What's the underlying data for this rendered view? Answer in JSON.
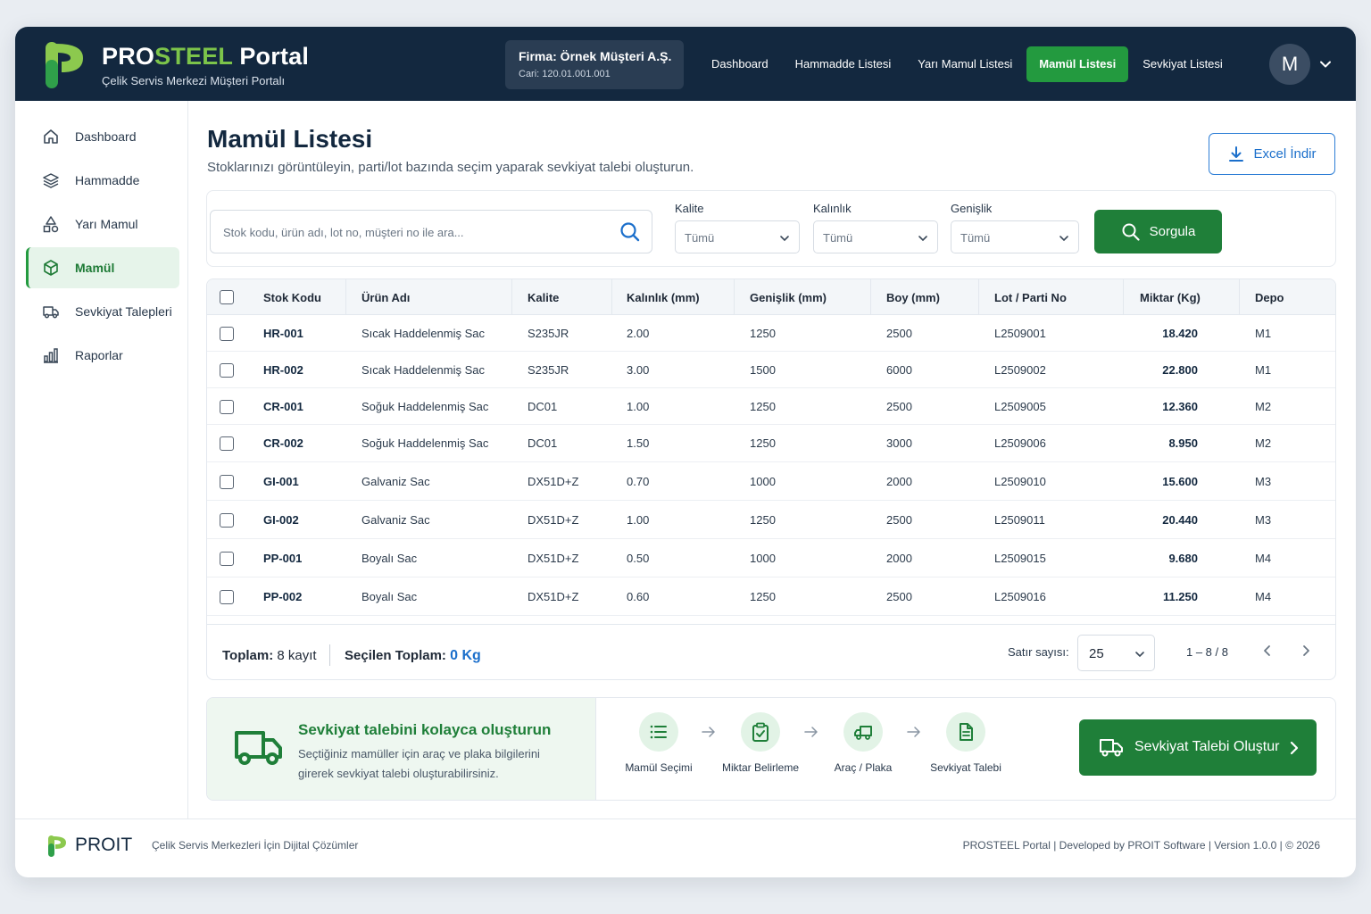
{
  "header": {
    "brand_pro": "PRO",
    "brand_steel": "STEEL",
    "brand_portal": " Portal",
    "subtitle": "Çelik Servis Merkezi Müşteri Portalı",
    "firm_name": "Firma: Örnek Müşteri A.Ş.",
    "firm_cari": "Cari: 120.01.001.001",
    "nav": [
      "Dashboard",
      "Hammadde Listesi",
      "Yarı Mamul Listesi",
      "Mamül Listesi",
      "Sevkiyat Listesi"
    ],
    "nav_active": "Mamül Listesi",
    "avatar_letter": "M"
  },
  "sidebar": {
    "items": [
      {
        "label": "Dashboard",
        "icon": "home-icon"
      },
      {
        "label": "Hammadde",
        "icon": "layers-icon"
      },
      {
        "label": "Yarı Mamul",
        "icon": "shapes-icon"
      },
      {
        "label": "Mamül",
        "icon": "cube-icon"
      },
      {
        "label": "Sevkiyat Talepleri",
        "icon": "truck-icon"
      },
      {
        "label": "Raporlar",
        "icon": "bar-chart-icon"
      }
    ],
    "active": "Mamül"
  },
  "main": {
    "title": "Mamül Listesi",
    "subtitle": "Stoklarınızı görüntüleyin, parti/lot bazında seçim yaparak sevkiyat talebi oluşturun.",
    "excel_label": "Excel İndir"
  },
  "filters": {
    "search_placeholder": "Stok kodu, ürün adı, lot no, müşteri no ile ara...",
    "kalite_label": "Kalite",
    "kalite_value": "Tümü",
    "kalinlik_label": "Kalınlık",
    "kalinlik_value": "Tümü",
    "genislik_label": "Genişlik",
    "genislik_value": "Tümü",
    "query_label": "Sorgula"
  },
  "table": {
    "columns": [
      "Stok Kodu",
      "Ürün Adı",
      "Kalite",
      "Kalınlık (mm)",
      "Genişlik (mm)",
      "Boy (mm)",
      "Lot / Parti No",
      "Miktar (Kg)",
      "Depo"
    ],
    "rows": [
      [
        "HR-001",
        "Sıcak Haddelenmiş Sac",
        "S235JR",
        "2.00",
        "1250",
        "2500",
        "L2509001",
        "18.420",
        "M1"
      ],
      [
        "HR-002",
        "Sıcak Haddelenmiş Sac",
        "S235JR",
        "3.00",
        "1500",
        "6000",
        "L2509002",
        "22.800",
        "M1"
      ],
      [
        "CR-001",
        "Soğuk Haddelenmiş Sac",
        "DC01",
        "1.00",
        "1250",
        "2500",
        "L2509005",
        "12.360",
        "M2"
      ],
      [
        "CR-002",
        "Soğuk Haddelenmiş Sac",
        "DC01",
        "1.50",
        "1250",
        "3000",
        "L2509006",
        "8.950",
        "M2"
      ],
      [
        "GI-001",
        "Galvaniz Sac",
        "DX51D+Z",
        "0.70",
        "1000",
        "2000",
        "L2509010",
        "15.600",
        "M3"
      ],
      [
        "GI-002",
        "Galvaniz Sac",
        "DX51D+Z",
        "1.00",
        "1250",
        "2500",
        "L2509011",
        "20.440",
        "M3"
      ],
      [
        "PP-001",
        "Boyalı Sac",
        "DX51D+Z",
        "0.50",
        "1000",
        "2000",
        "L2509015",
        "9.680",
        "M4"
      ],
      [
        "PP-002",
        "Boyalı Sac",
        "DX51D+Z",
        "0.60",
        "1250",
        "2500",
        "L2509016",
        "11.250",
        "M4"
      ]
    ],
    "total_prefix": "Toplam:",
    "total_value": "8 kayıt",
    "selected_prefix": "Seçilen Toplam:",
    "selected_value": "0 Kg",
    "rows_label": "Satır sayısı:",
    "rows_per_page": "25",
    "page_info": "1 – 8 / 8"
  },
  "shipment": {
    "title": "Sevkiyat talebini kolayca oluşturun",
    "desc": "Seçtiğiniz mamüller için araç ve plaka bilgilerini girerek sevkiyat talebi oluşturabilirsiniz.",
    "steps": [
      {
        "label": "Mamül Seçimi",
        "icon": "list-icon"
      },
      {
        "label": "Miktar Belirleme",
        "icon": "clipboard-check-icon"
      },
      {
        "label": "Araç / Plaka",
        "icon": "truck-icon"
      },
      {
        "label": "Sevkiyat Talebi",
        "icon": "document-icon"
      }
    ],
    "create_label": "Sevkiyat Talebi Oluştur"
  },
  "footer": {
    "brand": "PROIT",
    "tagline": "Çelik Servis Merkezleri İçin Dijital Çözümler",
    "right": "PROSTEEL Portal | Developed by PROIT Software | Version 1.0.0 | © 2026"
  },
  "colors": {
    "header_bg": "#13283f",
    "brand_green": "#7cc44a",
    "primary_green": "#1f7f39",
    "accent_blue": "#1b6fcb"
  }
}
